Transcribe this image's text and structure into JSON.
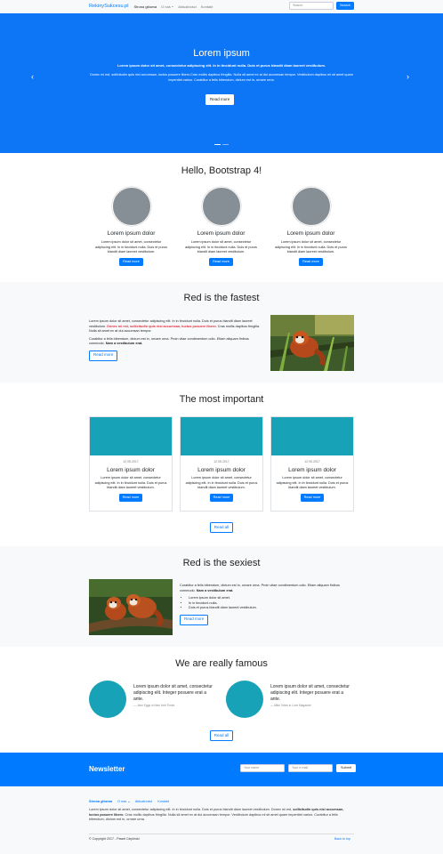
{
  "navbar": {
    "brand": "RekinySukcesu.pl",
    "links": [
      "Strona główna",
      "O nas",
      "Aktualności",
      "Kontakt"
    ],
    "search_placeholder": "Search",
    "search_button": "Search"
  },
  "carousel": {
    "title": "Lorem ipsum",
    "lead": "Lorem ipsum dolor sit amet, consectetur adipiscing elit. In in tincidunt nulla. Duis et purus blandit diam laoreet vestibulum.",
    "text": "Donec mi est, sollicitudin quis nisl accumsan, luctus posuere libero.Cras mollis dapibus fringilla. Nulla sit amet ex at dui accumsan tempor. Vestibulum dapibus mi sit amet quam imperdiet varius. Curabitur a felis bibendum, dictum est in, ornare urna.",
    "button": "Read more",
    "prev": "‹",
    "next": "›"
  },
  "hello": {
    "title": "Hello, Bootstrap 4!",
    "features": [
      {
        "title": "Lorem ipsum dolor",
        "text": "Lorem ipsum dolor sit amet, consectetur adipiscing elit. In in tincidunt nulla. Duis et purus blandit diam laoreet vestibulum.",
        "button": "Read more"
      },
      {
        "title": "Lorem ipsum dolor",
        "text": "Lorem ipsum dolor sit amet, consectetur adipiscing elit. In in tincidunt nulla. Duis et purus blandit diam laoreet vestibulum.",
        "button": "Read more"
      },
      {
        "title": "Lorem ipsum dolor",
        "text": "Lorem ipsum dolor sit amet, consectetur adipiscing elit. In in tincidunt nulla. Duis et purus blandit diam laoreet vestibulum.",
        "button": "Read more"
      }
    ]
  },
  "fastest": {
    "title": "Red is the fastest",
    "p1_start": "Lorem ipsum dolor sit amet, consectetur adipiscing elit. In in tincidunt nulla. Duis et purus blandit diam laoreet vestibulum. ",
    "p1_red": "Donec mi est, sollicitudin quis nisl accumsan, luctus posuere libero.",
    "p1_end": " Cras mollis dapibus fringilla. Nulla sit amet ex at dui accumsan tempor.",
    "p2_start": "Curabitur a felis bibendum, dictum est in, ornare urna. Proin vitae condimentum odio. Etiam aliquam finibus commodo. ",
    "p2_bold": "Nam a vestibulum erat.",
    "button": "Read more"
  },
  "important": {
    "title": "The most important",
    "cards": [
      {
        "date": "12.05.2017",
        "title": "Lorem ipsum dolor",
        "text": "Lorem ipsum dolor sit amet, consectetur adipiscing elit. In in tincidunt nulla. Duis et purus blandit diam laoreet vestibulum.",
        "button": "Read more"
      },
      {
        "date": "12.05.2017",
        "title": "Lorem ipsum dolor",
        "text": "Lorem ipsum dolor sit amet, consectetur adipiscing elit. In in tincidunt nulla. Duis et purus blandit diam laoreet vestibulum.",
        "button": "Read more"
      },
      {
        "date": "12.05.2017",
        "title": "Lorem ipsum dolor",
        "text": "Lorem ipsum dolor sit amet, consectetur adipiscing elit. In in tincidunt nulla. Duis et purus blandit diam laoreet vestibulum.",
        "button": "Read more"
      }
    ],
    "read_all": "Read all"
  },
  "sexiest": {
    "title": "Red is the sexiest",
    "p_start": "Curabitur a felis bibendum, dictum est in, ornare urna. Proin vitae condimentum odio. Etiam aliquam finibus commodo. ",
    "p_bold": "Nam a vestibulum erat.",
    "list": [
      "Lorem ipsum dolor sit amet.",
      "In in tincidunt nulla.",
      "Duis et purus blandit diam laoreet vestibulum."
    ],
    "button": "Read more"
  },
  "famous": {
    "title": "We are really famous",
    "quotes": [
      {
        "text": "Lorem ipsum dolor sit amet, consectetur adipiscing elit. Integer posuere erat a ante.",
        "footer": "— John Eggs in New York Times"
      },
      {
        "text": "Lorem ipsum dolor sit amet, consectetur adipiscing elit. Integer posuere erat a ante.",
        "footer": "— Mike Tokes in Love Magazine"
      }
    ],
    "read_all": "Read all"
  },
  "newsletter": {
    "title": "Newsletter",
    "name_placeholder": "Your name",
    "email_placeholder": "Your e-mail",
    "button": "Submit"
  },
  "footer": {
    "links": [
      "Strona główna",
      "O nas",
      "Aktualności",
      "Kontakt"
    ],
    "text_start": "Lorem ipsum dolor sit amet, consectetur adipiscing elit. In in tincidunt nulla. Duis et purus blandit diam laoreet vestibulum. Donec mi est, ",
    "text_bold": "sollicitudin quis nisl accumsan, luctus posuere libero",
    "text_end": ". Cras mollis dapibus fringilla. Nulla sit amet ex at dui accumsan tempor. Vestibulum dapibus mi sit amet quam imperdiet varius. Curabitur a felis bibendum, dictum est in, ornare urna.",
    "copyright": "© Copyright 2017 - Paweł Cieplński",
    "back_to_top": "Back to top"
  }
}
